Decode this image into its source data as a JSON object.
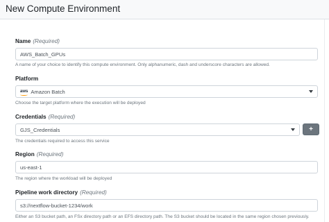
{
  "page": {
    "title": "New Compute Environment"
  },
  "required_marker": "(Required)",
  "fields": {
    "name": {
      "label": "Name",
      "value": "AWS_Batch_GPUs",
      "help": "A name of your choice to identify this compute environment. Only alphanumeric, dash and underscore characters are allowed."
    },
    "platform": {
      "label": "Platform",
      "value": "Amazon Batch",
      "logo_text": "aws",
      "help": "Choose the target platform where the execution will be deployed"
    },
    "credentials": {
      "label": "Credentials",
      "value": "GJS_Credentials",
      "add_button": "+",
      "help": "The credentials required to access this service"
    },
    "region": {
      "label": "Region",
      "value": "us-east-1",
      "help": "The region where the workload will be deployed"
    },
    "work_dir": {
      "label": "Pipeline work directory",
      "value": "s3://nextflow-bucket-1234/work",
      "help": "Either an S3 bucket path, an FSx directory path or an EFS directory path. The S3 bucket should be located in the same region chosen previously."
    }
  }
}
